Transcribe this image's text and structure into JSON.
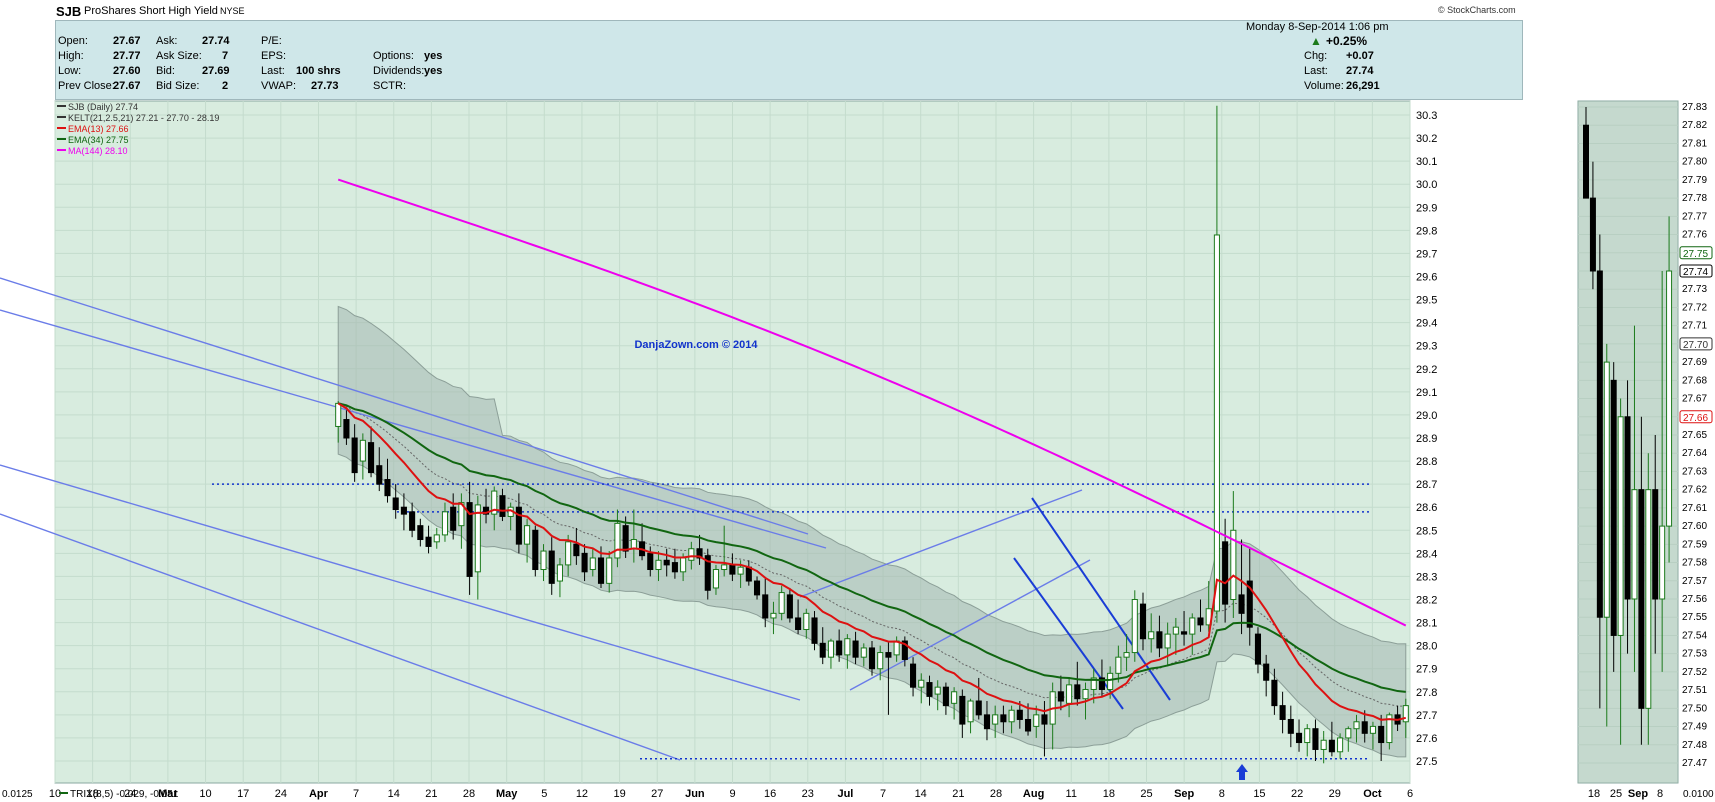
{
  "header": {
    "symbol": "SJB",
    "name": "ProShares Short High Yield",
    "exchange": "NYSE",
    "copyright": "© StockCharts.com"
  },
  "quote": {
    "labels": {
      "open": "Open:",
      "high": "High:",
      "low": "Low:",
      "prev_close": "Prev Close:",
      "ask": "Ask:",
      "ask_size": "Ask Size:",
      "bid": "Bid:",
      "bid_size": "Bid Size:",
      "pe": "P/E:",
      "eps": "EPS:",
      "last": "Last:",
      "vwap": "VWAP:",
      "options": "Options:",
      "dividends": "Dividends:",
      "sctr": "SCTR:",
      "chg": "Chg:",
      "last2": "Last:",
      "volume": "Volume:"
    },
    "open": "27.67",
    "high": "27.77",
    "low": "27.60",
    "prev_close": "27.67",
    "ask": "27.74",
    "ask_size": "7",
    "bid": "27.69",
    "bid_size": "2",
    "last": "100 shrs",
    "vwap": "27.73",
    "options": "yes",
    "dividends": "yes",
    "date": "Monday  8-Sep-2014  1:06 pm",
    "pct_change": "+0.25%",
    "chg": "+0.07",
    "last_price": "27.74",
    "volume": "26,291"
  },
  "legend": {
    "l1": "SJB (Daily) 27.74",
    "l2": "KELT(21,2.5,21) 27.21 - 27.70 - 28.19",
    "l3": "EMA(13) 27.66",
    "l4": "EMA(34) 27.75",
    "l5": "MA(144) 28.10"
  },
  "watermark": "DanjaZown.com © 2014",
  "colors": {
    "up": "#1b7a1b",
    "down": "#000000",
    "ema13": "#dd1111",
    "ema34": "#116611",
    "ma144": "#ee00ee",
    "channel": "#6a7ce8",
    "dotted": "#1133cc",
    "bg": "#d8ecdf",
    "band": "#a4b8b0"
  },
  "chart_data": {
    "type": "candlestick",
    "ylim": [
      27.45,
      30.35
    ],
    "y_ticks": [
      "30.3",
      "30.2",
      "30.1",
      "30.0",
      "29.9",
      "29.8",
      "29.7",
      "29.6",
      "29.5",
      "29.4",
      "29.3",
      "29.2",
      "29.1",
      "29.0",
      "28.9",
      "28.8",
      "28.7",
      "28.6",
      "28.5",
      "28.4",
      "28.3",
      "28.2",
      "28.1",
      "28.0",
      "27.9",
      "27.8",
      "27.7",
      "27.6",
      "27.5"
    ],
    "x_ticks": [
      "10",
      "18",
      "24",
      "Mar",
      "10",
      "17",
      "24",
      "Apr",
      "7",
      "14",
      "21",
      "28",
      "May",
      "5",
      "12",
      "19",
      "27",
      "Jun",
      "9",
      "16",
      "23",
      "Jul",
      "7",
      "14",
      "21",
      "28",
      "Aug",
      "11",
      "18",
      "25",
      "Sep",
      "8",
      "15",
      "22",
      "29",
      "Oct",
      "6"
    ],
    "ohlc": [
      [
        28.95,
        29.06,
        28.88,
        29.05
      ],
      [
        28.98,
        29.02,
        28.87,
        28.9
      ],
      [
        28.9,
        28.96,
        28.71,
        28.75
      ],
      [
        28.8,
        28.92,
        28.72,
        28.89
      ],
      [
        28.88,
        28.95,
        28.73,
        28.75
      ],
      [
        28.78,
        28.86,
        28.67,
        28.7
      ],
      [
        28.72,
        28.81,
        28.62,
        28.65
      ],
      [
        28.64,
        28.7,
        28.55,
        28.59
      ],
      [
        28.6,
        28.66,
        28.5,
        28.57
      ],
      [
        28.58,
        28.62,
        28.47,
        28.5
      ],
      [
        28.52,
        28.55,
        28.43,
        28.46
      ],
      [
        28.47,
        28.52,
        28.4,
        28.43
      ],
      [
        28.45,
        28.51,
        28.42,
        28.48
      ],
      [
        28.48,
        28.62,
        28.45,
        28.58
      ],
      [
        28.6,
        28.66,
        28.46,
        28.5
      ],
      [
        28.52,
        28.66,
        28.42,
        28.62
      ],
      [
        28.62,
        28.71,
        28.22,
        28.3
      ],
      [
        28.32,
        28.65,
        28.2,
        28.61
      ],
      [
        28.6,
        28.68,
        28.53,
        28.57
      ],
      [
        28.57,
        28.69,
        28.5,
        28.67
      ],
      [
        28.65,
        28.68,
        28.54,
        28.56
      ],
      [
        28.56,
        28.62,
        28.5,
        28.6
      ],
      [
        28.6,
        28.66,
        28.4,
        28.44
      ],
      [
        28.44,
        28.55,
        28.36,
        28.52
      ],
      [
        28.5,
        28.52,
        28.3,
        28.33
      ],
      [
        28.33,
        28.44,
        28.28,
        28.41
      ],
      [
        28.41,
        28.47,
        28.22,
        28.27
      ],
      [
        28.28,
        28.38,
        28.21,
        28.35
      ],
      [
        28.35,
        28.48,
        28.3,
        28.45
      ],
      [
        28.44,
        28.51,
        28.35,
        28.39
      ],
      [
        28.4,
        28.44,
        28.28,
        28.32
      ],
      [
        28.33,
        28.42,
        28.3,
        28.38
      ],
      [
        28.38,
        28.43,
        28.25,
        28.27
      ],
      [
        28.27,
        28.41,
        28.23,
        28.38
      ],
      [
        28.38,
        28.59,
        28.34,
        28.53
      ],
      [
        28.52,
        28.56,
        28.38,
        28.41
      ],
      [
        28.42,
        28.59,
        28.36,
        28.46
      ],
      [
        28.45,
        28.53,
        28.37,
        28.39
      ],
      [
        28.4,
        28.43,
        28.3,
        28.33
      ],
      [
        28.33,
        28.41,
        28.28,
        28.37
      ],
      [
        28.37,
        28.42,
        28.3,
        28.35
      ],
      [
        28.36,
        28.42,
        28.29,
        28.32
      ],
      [
        28.32,
        28.4,
        28.28,
        28.38
      ],
      [
        28.37,
        28.45,
        28.33,
        28.42
      ],
      [
        28.42,
        28.48,
        28.35,
        28.38
      ],
      [
        28.39,
        28.42,
        28.2,
        28.24
      ],
      [
        28.25,
        28.35,
        28.22,
        28.33
      ],
      [
        28.33,
        28.52,
        28.3,
        28.35
      ],
      [
        28.35,
        28.4,
        28.28,
        28.31
      ],
      [
        28.31,
        28.37,
        28.25,
        28.34
      ],
      [
        28.34,
        28.37,
        28.26,
        28.28
      ],
      [
        28.28,
        28.3,
        28.2,
        28.22
      ],
      [
        28.22,
        28.29,
        28.08,
        28.12
      ],
      [
        28.12,
        28.19,
        28.05,
        28.14
      ],
      [
        28.14,
        28.26,
        28.11,
        28.23
      ],
      [
        28.22,
        28.25,
        28.1,
        28.12
      ],
      [
        28.12,
        28.2,
        28.05,
        28.07
      ],
      [
        28.07,
        28.16,
        28.03,
        28.14
      ],
      [
        28.12,
        28.15,
        27.98,
        28.01
      ],
      [
        28.01,
        28.08,
        27.92,
        27.95
      ],
      [
        27.95,
        28.03,
        27.9,
        28.02
      ],
      [
        28.02,
        28.07,
        27.93,
        27.96
      ],
      [
        27.96,
        28.05,
        27.9,
        28.03
      ],
      [
        28.02,
        28.06,
        27.92,
        27.95
      ],
      [
        27.95,
        28.01,
        27.91,
        27.99
      ],
      [
        27.99,
        28.02,
        27.87,
        27.9
      ],
      [
        27.9,
        28.0,
        27.85,
        27.97
      ],
      [
        27.97,
        28.02,
        27.7,
        27.95
      ],
      [
        27.96,
        28.04,
        27.93,
        28.02
      ],
      [
        28.02,
        28.04,
        27.91,
        27.94
      ],
      [
        27.92,
        27.95,
        27.78,
        27.82
      ],
      [
        27.82,
        27.88,
        27.75,
        27.85
      ],
      [
        27.84,
        27.87,
        27.74,
        27.78
      ],
      [
        27.79,
        27.85,
        27.72,
        27.82
      ],
      [
        27.82,
        27.84,
        27.7,
        27.74
      ],
      [
        27.75,
        27.82,
        27.68,
        27.8
      ],
      [
        27.78,
        27.81,
        27.6,
        27.66
      ],
      [
        27.67,
        27.77,
        27.62,
        27.76
      ],
      [
        27.76,
        27.86,
        27.68,
        27.7
      ],
      [
        27.7,
        27.76,
        27.59,
        27.64
      ],
      [
        27.66,
        27.74,
        27.6,
        27.7
      ],
      [
        27.7,
        27.74,
        27.62,
        27.67
      ],
      [
        27.67,
        27.74,
        27.62,
        27.72
      ],
      [
        27.72,
        27.76,
        27.64,
        27.68
      ],
      [
        27.68,
        27.75,
        27.61,
        27.63
      ],
      [
        27.65,
        27.74,
        27.6,
        27.7
      ],
      [
        27.7,
        27.76,
        27.52,
        27.66
      ],
      [
        27.66,
        27.84,
        27.55,
        27.8
      ],
      [
        27.8,
        27.87,
        27.72,
        27.76
      ],
      [
        27.75,
        27.86,
        27.69,
        27.83
      ],
      [
        27.83,
        27.93,
        27.74,
        27.77
      ],
      [
        27.77,
        27.84,
        27.68,
        27.81
      ],
      [
        27.81,
        27.9,
        27.75,
        27.86
      ],
      [
        27.86,
        27.94,
        27.78,
        27.81
      ],
      [
        27.81,
        27.91,
        27.77,
        27.88
      ],
      [
        27.88,
        28.0,
        27.84,
        27.95
      ],
      [
        27.95,
        28.05,
        27.89,
        27.97
      ],
      [
        27.97,
        28.24,
        27.93,
        28.2
      ],
      [
        28.18,
        28.23,
        27.98,
        28.03
      ],
      [
        28.03,
        28.14,
        27.97,
        28.06
      ],
      [
        28.06,
        28.13,
        27.95,
        27.99
      ],
      [
        27.99,
        28.1,
        27.91,
        28.05
      ],
      [
        28.05,
        28.12,
        27.96,
        28.08
      ],
      [
        28.06,
        28.15,
        28.0,
        28.05
      ],
      [
        28.05,
        28.14,
        27.96,
        28.12
      ],
      [
        28.12,
        28.2,
        28.06,
        28.09
      ],
      [
        28.09,
        28.28,
        28.06,
        28.16
      ],
      [
        28.15,
        30.34,
        28.1,
        29.78
      ],
      [
        28.45,
        28.55,
        28.1,
        28.18
      ],
      [
        28.2,
        28.67,
        28.12,
        28.5
      ],
      [
        28.22,
        28.46,
        28.05,
        28.14
      ],
      [
        28.28,
        28.42,
        28.0,
        28.08
      ],
      [
        28.05,
        28.08,
        27.88,
        27.92
      ],
      [
        27.92,
        27.96,
        27.78,
        27.85
      ],
      [
        27.85,
        27.9,
        27.7,
        27.74
      ],
      [
        27.74,
        27.8,
        27.62,
        27.68
      ],
      [
        27.68,
        27.74,
        27.56,
        27.62
      ],
      [
        27.62,
        27.68,
        27.54,
        27.58
      ],
      [
        27.58,
        27.66,
        27.52,
        27.64
      ],
      [
        27.64,
        27.68,
        27.5,
        27.55
      ],
      [
        27.55,
        27.63,
        27.49,
        27.59
      ],
      [
        27.59,
        27.67,
        27.52,
        27.54
      ],
      [
        27.54,
        27.62,
        27.51,
        27.6
      ],
      [
        27.6,
        27.65,
        27.54,
        27.64
      ],
      [
        27.64,
        27.7,
        27.58,
        27.67
      ],
      [
        27.67,
        27.72,
        27.58,
        27.62
      ],
      [
        27.62,
        27.67,
        27.55,
        27.65
      ],
      [
        27.65,
        27.7,
        27.5,
        27.58
      ],
      [
        27.58,
        27.71,
        27.55,
        27.7
      ],
      [
        27.7,
        27.74,
        27.63,
        27.66
      ],
      [
        27.67,
        27.77,
        27.6,
        27.74
      ]
    ],
    "mini_ohlc": [
      [
        27.82,
        27.83,
        27.78,
        27.78
      ],
      [
        27.78,
        27.8,
        27.73,
        27.74
      ],
      [
        27.74,
        27.76,
        27.5,
        27.55
      ],
      [
        27.55,
        27.7,
        27.49,
        27.69
      ],
      [
        27.68,
        27.69,
        27.52,
        27.54
      ],
      [
        27.54,
        27.67,
        27.48,
        27.66
      ],
      [
        27.66,
        27.68,
        27.53,
        27.56
      ],
      [
        27.56,
        27.71,
        27.52,
        27.62
      ],
      [
        27.62,
        27.66,
        27.48,
        27.5
      ],
      [
        27.5,
        27.64,
        27.48,
        27.62
      ],
      [
        27.62,
        27.65,
        27.53,
        27.56
      ],
      [
        27.56,
        27.74,
        27.52,
        27.6
      ],
      [
        27.6,
        27.77,
        27.58,
        27.74
      ]
    ],
    "mini_ylim": [
      27.465,
      27.835
    ],
    "mini_y_ticks": [
      "27.83",
      "27.82",
      "27.81",
      "27.80",
      "27.79",
      "27.78",
      "27.77",
      "27.76",
      "27.75",
      "27.74",
      "27.73",
      "27.72",
      "27.71",
      "27.70",
      "27.69",
      "27.68",
      "27.67",
      "27.66",
      "27.65",
      "27.64",
      "27.63",
      "27.62",
      "27.61",
      "27.60",
      "27.59",
      "27.58",
      "27.57",
      "27.56",
      "27.55",
      "27.54",
      "27.53",
      "27.52",
      "27.51",
      "27.50",
      "27.49",
      "27.48",
      "27.47"
    ],
    "mini_x_ticks": [
      "18",
      "25",
      "Sep",
      "8"
    ],
    "mini_markers": [
      "27.75",
      "27.74",
      "27.70",
      "27.66"
    ],
    "hlines": [
      28.7,
      28.58,
      27.51
    ],
    "indicator": {
      "name": "TRIX(8,5)",
      "values": "-0.029, -0.051",
      "axis_label": "0.0125",
      "right_label": "0.0100"
    }
  }
}
